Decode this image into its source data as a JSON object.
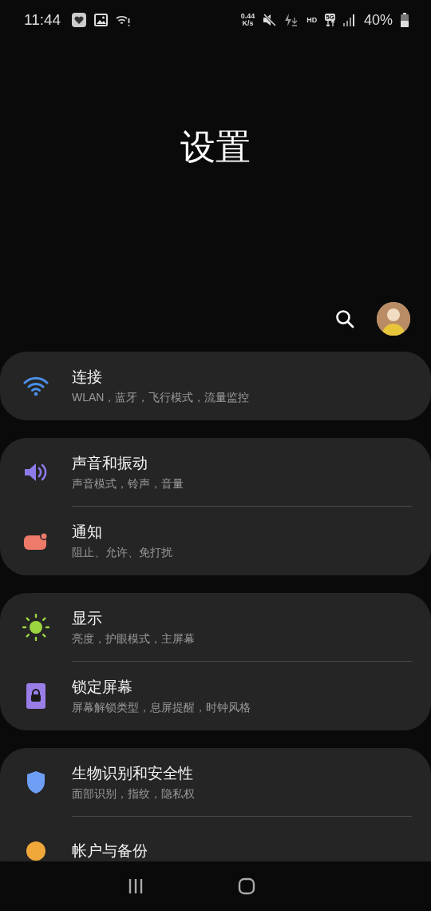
{
  "status_bar": {
    "time": "11:44",
    "speed_value": "0.44",
    "speed_unit": "K/s",
    "hd": "HD",
    "network": "5G",
    "battery": "40%"
  },
  "title": "设置",
  "groups": [
    {
      "items": [
        {
          "kind": "wifi",
          "title": "连接",
          "subtitle": "WLAN，蓝牙，飞行模式，流量监控"
        }
      ]
    },
    {
      "items": [
        {
          "kind": "sound",
          "title": "声音和振动",
          "subtitle": "声音模式，铃声，音量"
        },
        {
          "kind": "notification",
          "title": "通知",
          "subtitle": "阻止、允许、免打扰"
        }
      ]
    },
    {
      "items": [
        {
          "kind": "display",
          "title": "显示",
          "subtitle": "亮度，护眼模式，主屏幕"
        },
        {
          "kind": "lock",
          "title": "锁定屏幕",
          "subtitle": "屏幕解锁类型，息屏提醒，时钟风格"
        }
      ]
    },
    {
      "items": [
        {
          "kind": "security",
          "title": "生物识别和安全性",
          "subtitle": "面部识别，指纹，隐私权"
        },
        {
          "kind": "account",
          "title": "帐户与备份"
        }
      ]
    }
  ]
}
